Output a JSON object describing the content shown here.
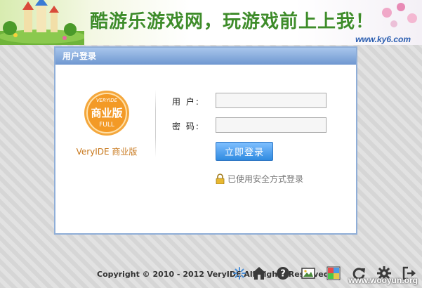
{
  "banner": {
    "slogan": "酷游乐游戏网，玩游戏前上上我！",
    "url": "www.ky6.com"
  },
  "panel": {
    "title": "用户登录"
  },
  "logo": {
    "badge_top": "VERYIDE",
    "badge_main": "商业版",
    "badge_bottom": "FULL",
    "brand": "VeryIDE 商业版"
  },
  "form": {
    "username_label": "用 户:",
    "password_label": "密 码:",
    "username_value": "",
    "password_value": "",
    "submit_label": "立即登录",
    "secure_text": "已使用安全方式登录"
  },
  "footer": {
    "copyright": "Copyright © 2010 - 2012 VeryIDE All Rights Reserved",
    "watermark": "www.wooyun.org"
  },
  "toolbar": {
    "icons": [
      "loading-icon",
      "home-icon",
      "help-icon",
      "image-icon",
      "palette-icon",
      "refresh-icon",
      "settings-icon",
      "logout-icon"
    ]
  },
  "colors": {
    "accent": "#2f8ae0",
    "panel_border": "#8faed8",
    "brand_orange": "#c8781c",
    "slogan_green": "#3e8c2a"
  }
}
